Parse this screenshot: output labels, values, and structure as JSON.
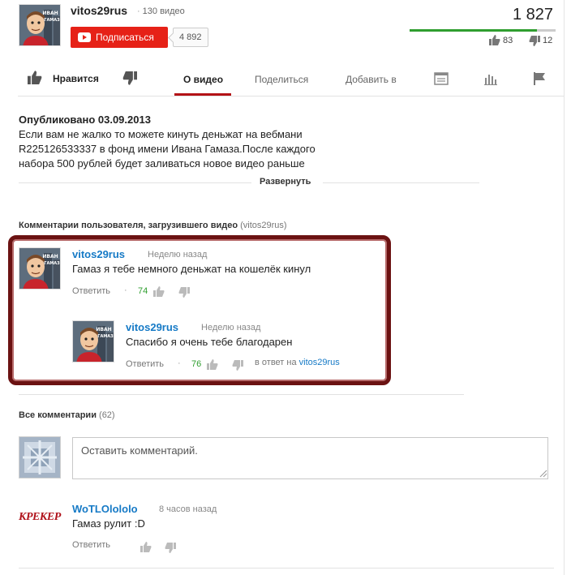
{
  "channel": {
    "name": "vitos29rus",
    "video_count": "130 видео",
    "avatar_caption_line1": "ИВАН",
    "avatar_caption_line2": "ГАМАЗ",
    "subscribe_label": "Подписаться",
    "subscriber_count": "4 892"
  },
  "stats": {
    "views": "1 827",
    "likes": "83",
    "dislikes": "12",
    "like_ratio": 0.87,
    "rating_fill_color": "#2f9e2f"
  },
  "tabs": {
    "like": "Нравится",
    "about": "О видео",
    "share": "Поделиться",
    "add_to": "Добавить в"
  },
  "description": {
    "published": "Опубликовано 03.09.2013",
    "text": "Если вам не жалко то можете кинуть деньжат на вебмани R225126533337 в фонд имени Ивана Гамаза.После каждого набора 500 рублей будет заливаться новое видео раньше",
    "expand": "Развернуть"
  },
  "uploader_comments": {
    "heading": "Комментарии пользователя, загрузившего видео",
    "heading_user": "(vitos29rus)",
    "items": [
      {
        "author": "vitos29rus",
        "time": "Неделю назад",
        "text": "Гамаз я тебе немного деньжат на кошелёк кинул",
        "reply": "Ответить",
        "likes": "74"
      },
      {
        "author": "vitos29rus",
        "time": "Неделю назад",
        "text": "Спасибо я очень тебе благодарен",
        "reply": "Ответить",
        "likes": "76",
        "in_reply_prefix": "в ответ на",
        "in_reply_user": "vitos29rus"
      }
    ]
  },
  "all_comments": {
    "heading": "Все комментарии",
    "count": "(62)",
    "input_placeholder": "Оставить комментарий.",
    "items": [
      {
        "author": "WoTLOlololo",
        "time": "8 часов назад",
        "text": "Гамаз рулит :D",
        "reply": "Ответить",
        "avatar_text": "КРЕКЕР"
      }
    ]
  },
  "colors": {
    "accent_red": "#e62117",
    "link_blue": "#167ac6",
    "highlight_border": "#6b1212",
    "tab_underline": "#b31217"
  }
}
